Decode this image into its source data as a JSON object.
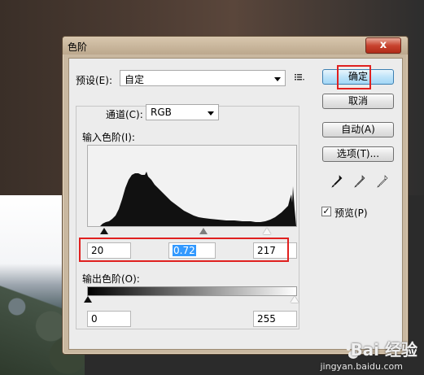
{
  "window": {
    "title": "色阶",
    "close_glyph": "x"
  },
  "preset": {
    "label": "预设(E):",
    "value": "自定",
    "menu_icon": "list-menu-icon"
  },
  "channel": {
    "label": "通道(C):",
    "value": "RGB"
  },
  "input_levels": {
    "label": "输入色阶(I):",
    "black": "20",
    "gamma": "0.72",
    "white": "217"
  },
  "output_levels": {
    "label": "输出色阶(O):",
    "black": "0",
    "white": "255"
  },
  "buttons": {
    "ok": "确定",
    "cancel": "取消",
    "auto": "自动(A)",
    "options": "选项(T)..."
  },
  "eyedroppers": [
    "black-eyedropper-icon",
    "gray-eyedropper-icon",
    "white-eyedropper-icon"
  ],
  "preview": {
    "label": "预览(P)",
    "checked": true,
    "check_glyph": "✓"
  },
  "watermark": {
    "text": "Bai 经验",
    "url": "jingyan.baidu.com"
  },
  "colors": {
    "highlight_red": "#e0201f",
    "default_button": "#bfe4f9",
    "selection": "#3399ff"
  }
}
